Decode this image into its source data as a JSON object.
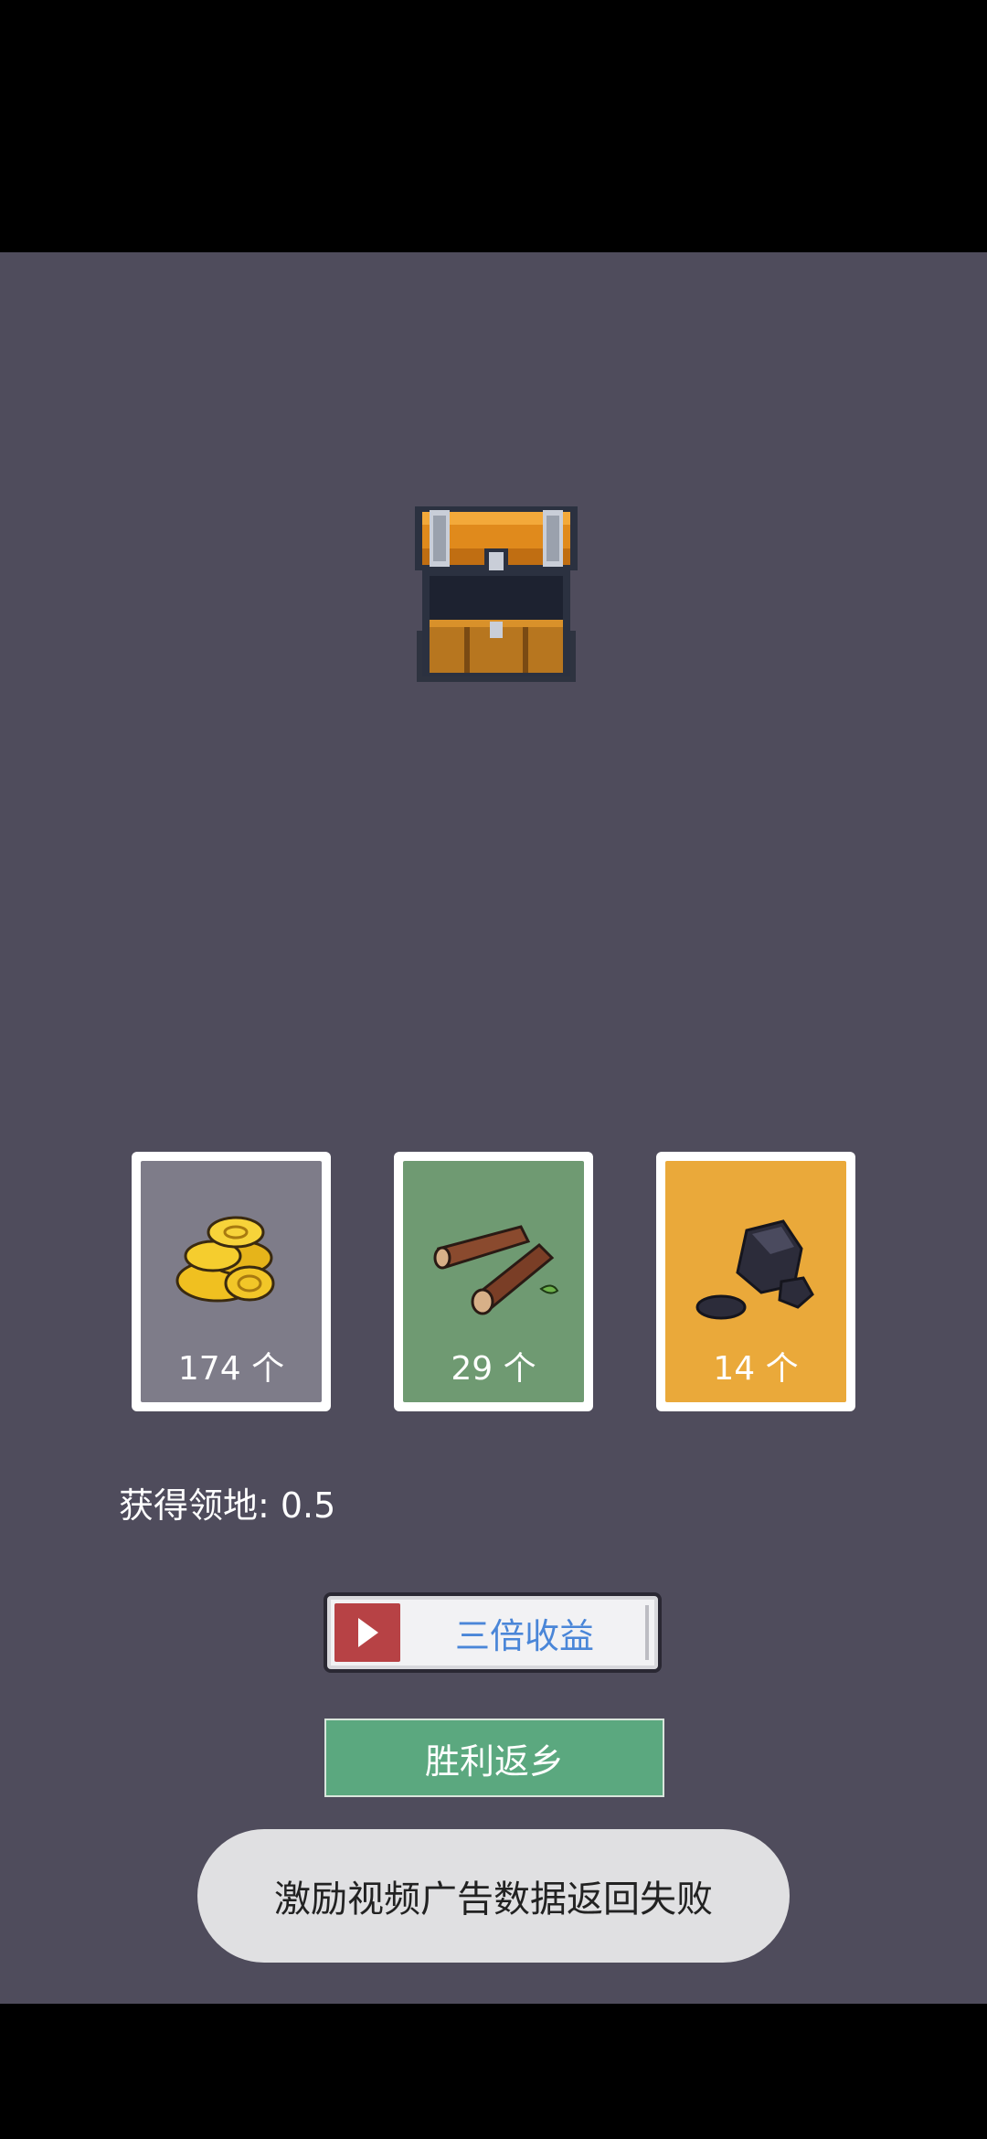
{
  "rewards": [
    {
      "item": "gold-coins",
      "count": "174 个",
      "color": "#7e7c89"
    },
    {
      "item": "wood-logs",
      "count": "29 个",
      "color": "#6f9a72"
    },
    {
      "item": "coal",
      "count": "14 个",
      "color": "#eaa93a"
    }
  ],
  "territory_label": "获得领地: 0.5",
  "buttons": {
    "triple_reward": "三倍收益",
    "return_home": "胜利返乡"
  },
  "toast": "激励视频广告数据返回失败",
  "colors": {
    "background": "#4f4c5c",
    "return_button": "#5ba87f",
    "play_icon_box": "#b74245",
    "triple_label": "#4a86d8"
  }
}
